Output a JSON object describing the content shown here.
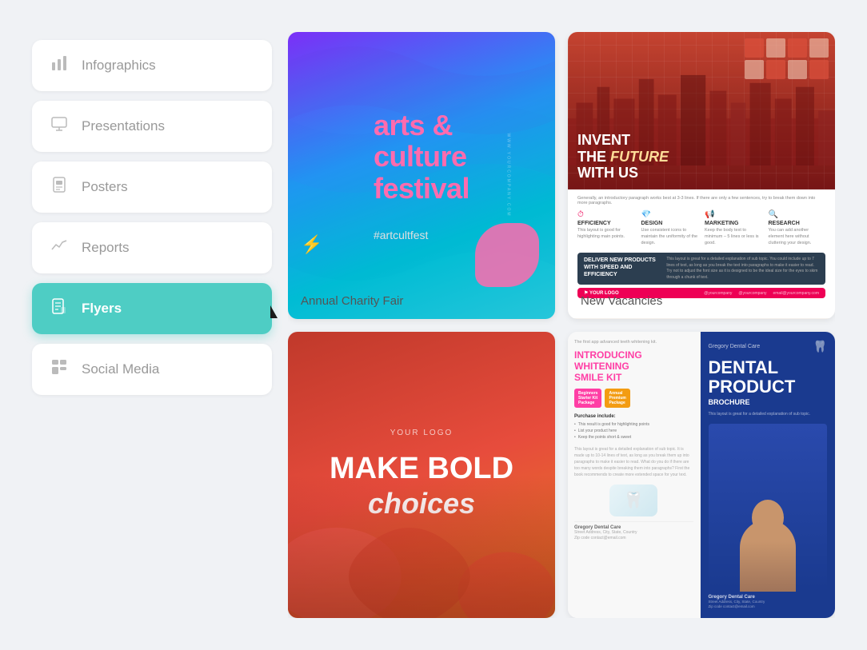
{
  "sidebar": {
    "items": [
      {
        "id": "infographics",
        "label": "Infographics",
        "icon": "📊",
        "active": false
      },
      {
        "id": "presentations",
        "label": "Presentations",
        "icon": "🖼",
        "active": false
      },
      {
        "id": "posters",
        "label": "Posters",
        "icon": "🖼",
        "active": false
      },
      {
        "id": "reports",
        "label": "Reports",
        "icon": "📈",
        "active": false
      },
      {
        "id": "flyers",
        "label": "Flyers",
        "icon": "📋",
        "active": true
      },
      {
        "id": "social-media",
        "label": "Social Media",
        "icon": "📊",
        "active": false
      }
    ]
  },
  "cards": [
    {
      "id": "arts-culture",
      "title": "arts & culture festival",
      "hashtag": "#artcultfest",
      "label": "Annual Charity Fair"
    },
    {
      "id": "invent-future",
      "headline_line1": "INVENT",
      "headline_line2": "THE FUTURE",
      "headline_line3": "WITH US",
      "label": "New Vacancies",
      "stats": [
        "EFFICIENCY",
        "DESIGN",
        "MARKETING",
        "RESEARCH"
      ],
      "deliver_title": "DELIVER NEW PRODUCTS WITH SPEED AND EFFICIENCY"
    },
    {
      "id": "bold-choices",
      "logo": "YOUR LOGO",
      "line1": "make bold",
      "line2": "choices"
    },
    {
      "id": "dental",
      "intro": "INTRODUCING",
      "product": "WHITENING SMILE KIT",
      "brand": "DENTAL PRODUCT",
      "brochure": "BROCHURE",
      "packages": [
        "Beginners Starter Kit Package",
        "Annual Premium Package"
      ],
      "right_title_line1": "DENTAL",
      "right_title_line2": "PRODUCT",
      "right_subtitle": "BROCHURE",
      "doctor": "Gregory Dental Care"
    }
  ],
  "colors": {
    "sidebar_active": "#4ecdc4",
    "arts_pink": "#ff6bae",
    "future_red": "#e05",
    "bold_red": "#c0392b",
    "dental_blue": "#1a3a8f",
    "dental_pink": "#ff3ea5"
  }
}
